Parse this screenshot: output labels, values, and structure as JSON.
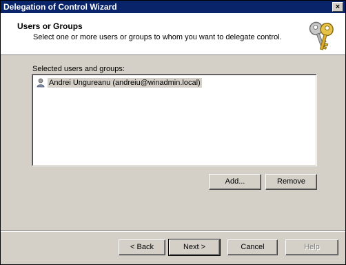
{
  "window": {
    "title": "Delegation of Control Wizard",
    "close_symbol": "×"
  },
  "header": {
    "title": "Users or Groups",
    "subtitle": "Select one or more users or groups to whom you want to delegate control.",
    "icon": "keys-icon"
  },
  "selection": {
    "label": "Selected users and groups:",
    "items": [
      {
        "icon": "user-icon",
        "label": "Andrei Ungureanu (andreiu@winadmin.local)",
        "selected": true
      }
    ]
  },
  "list_buttons": {
    "add": "Add...",
    "remove": "Remove"
  },
  "nav_buttons": {
    "back": "< Back",
    "next": "Next >",
    "cancel": "Cancel",
    "help": "Help"
  },
  "colors": {
    "titlebar": "#0a246a",
    "face": "#d4d0c8",
    "selection_bg": "#d4d0c8"
  }
}
